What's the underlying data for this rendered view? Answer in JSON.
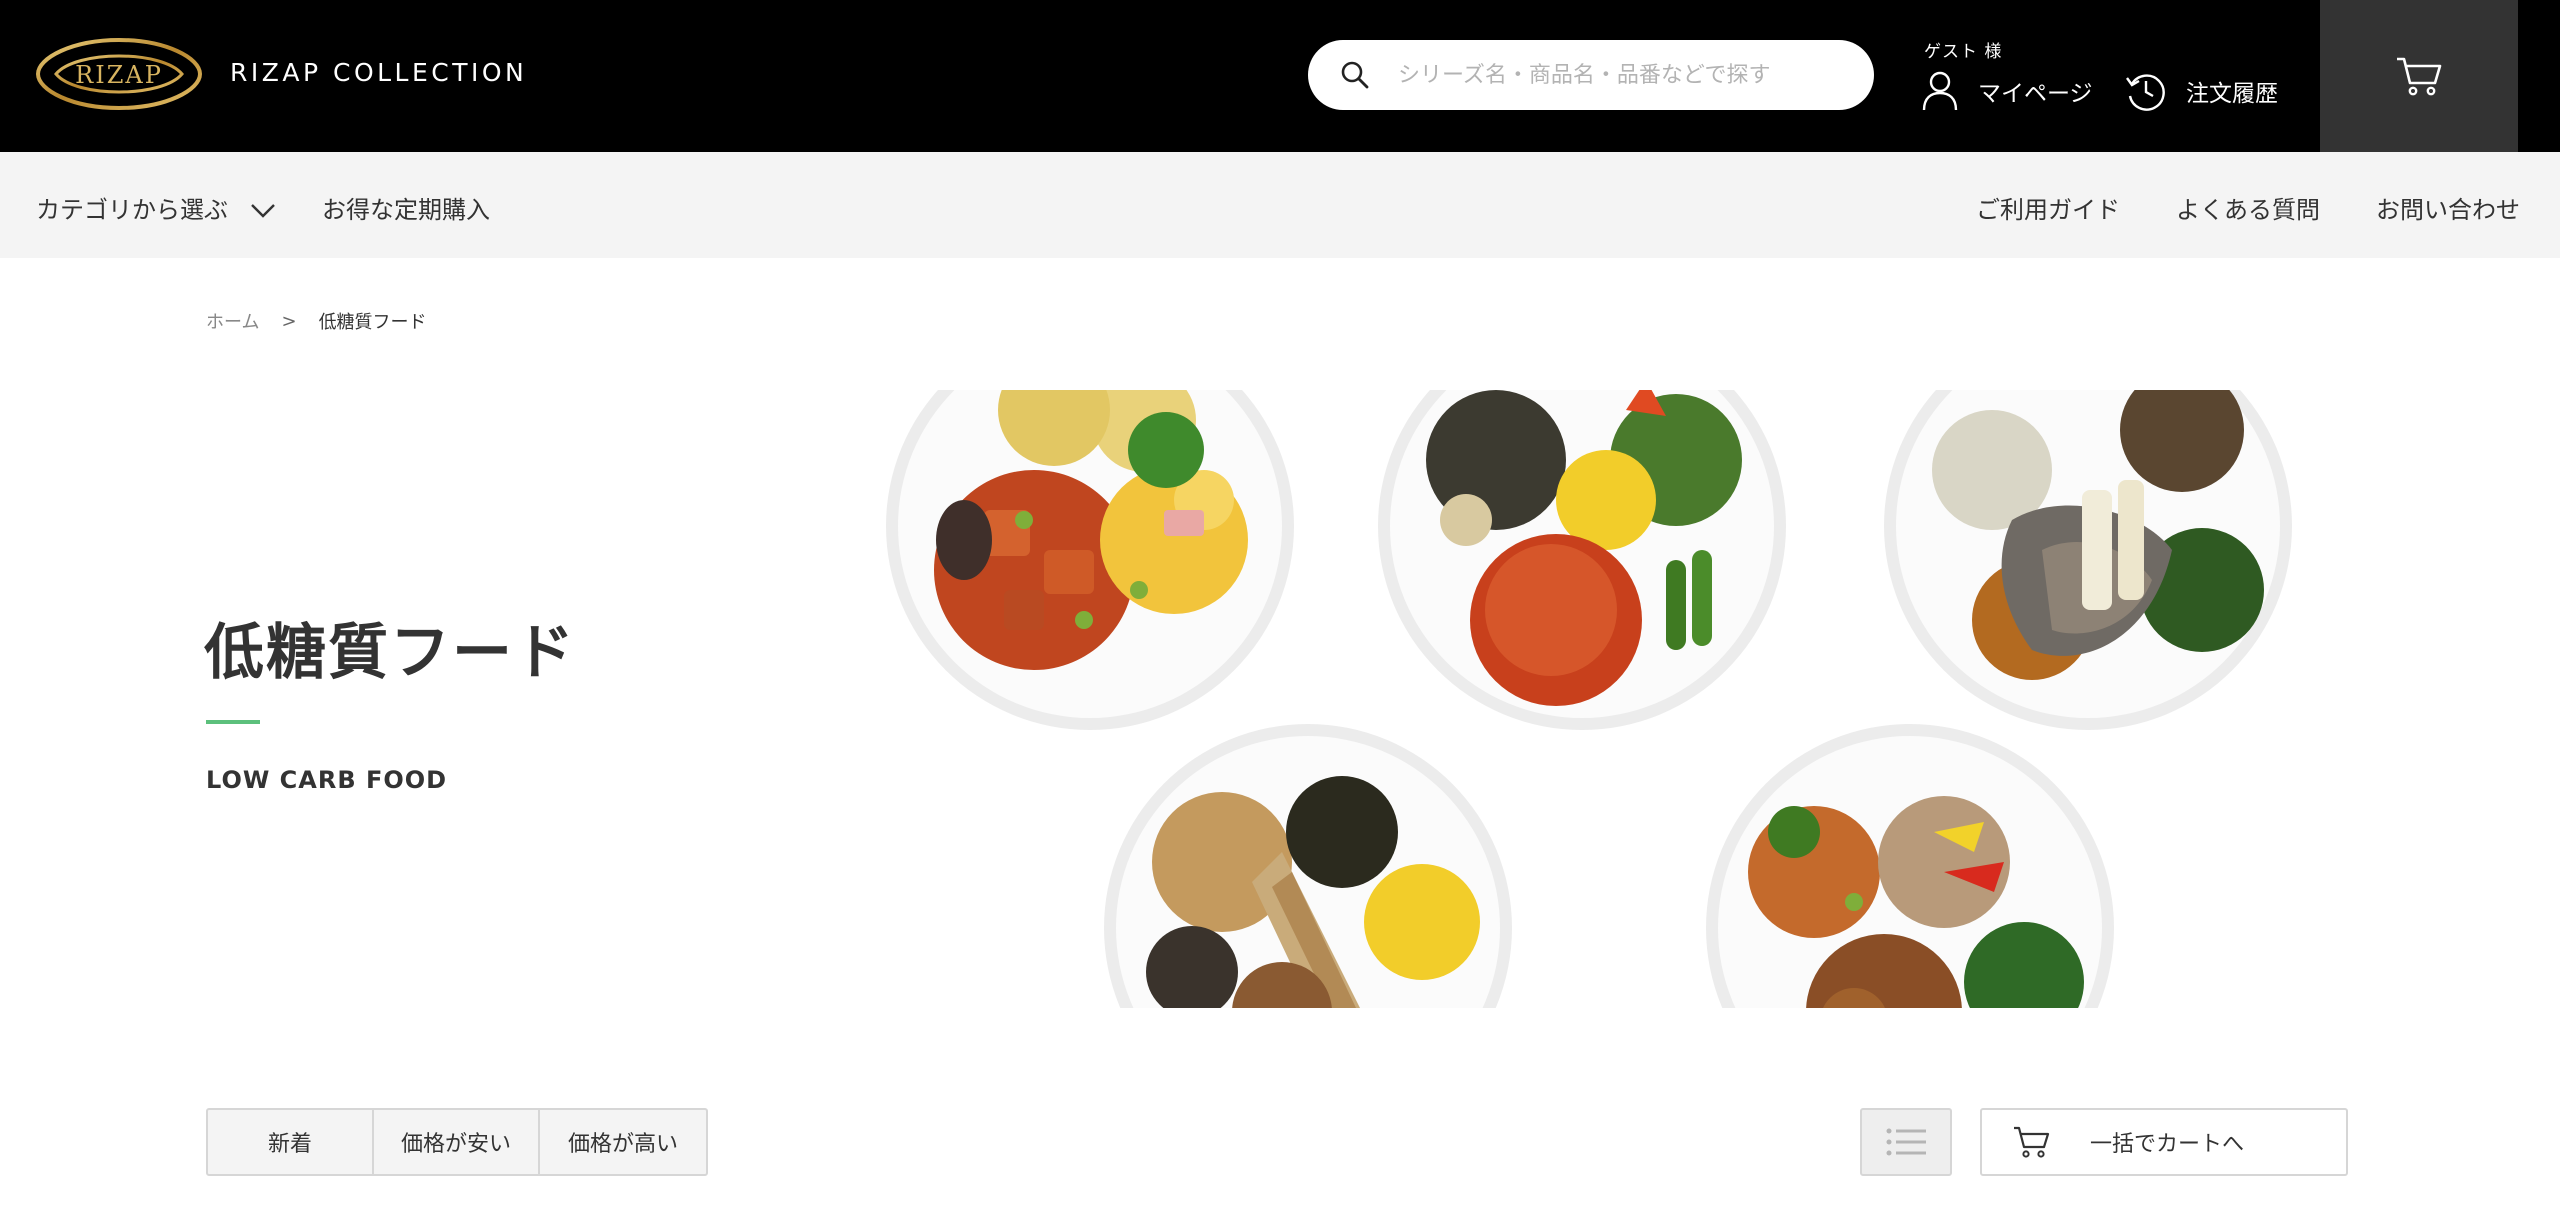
{
  "header": {
    "logo_text": "RIZAP",
    "brand_name": "RIZAP COLLECTION",
    "search_placeholder": "シリーズ名・商品名・品番などで探す",
    "guest_label": "ゲスト 様",
    "mypage_label": "マイページ",
    "history_label": "注文履歴",
    "icons": [
      "search-icon",
      "user-icon",
      "history-icon",
      "cart-icon"
    ]
  },
  "subnav": {
    "category_label": "カテゴリから選ぶ",
    "subscription_label": "お得な定期購入",
    "guide_label": "ご利用ガイド",
    "faq_label": "よくある質問",
    "contact_label": "お問い合わせ"
  },
  "breadcrumb": {
    "home": "ホーム",
    "separator": ">",
    "current": "低糖質フード"
  },
  "hero": {
    "title": "低糖質フード",
    "subtitle": "LOW CARB FOOD",
    "accent_color": "#5cc07c"
  },
  "sort": {
    "options": [
      "新着",
      "価格が安い",
      "価格が高い"
    ]
  },
  "bulk_cart_label": "一括でカートへ",
  "colors": {
    "header_bg": "#000000",
    "cart_bg": "#333333",
    "subnav_bg": "#f4f4f4",
    "logo_gold": "#c9a24a"
  }
}
